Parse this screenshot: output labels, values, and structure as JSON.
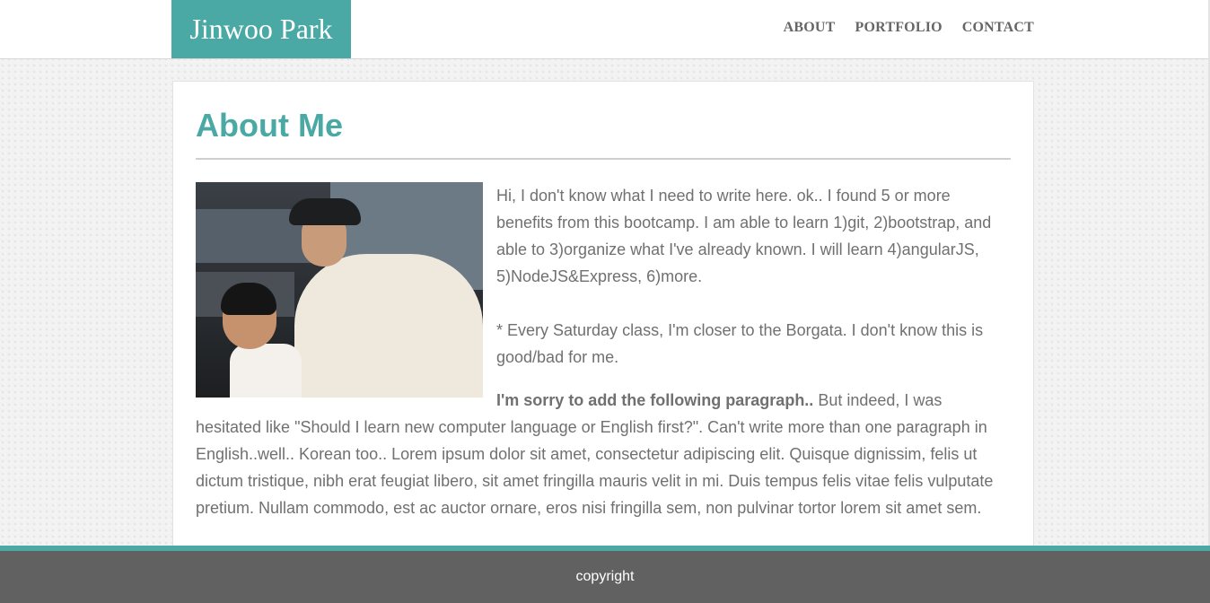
{
  "header": {
    "brand": "Jinwoo Park",
    "nav": [
      "ABOUT",
      "PORTFOLIO",
      "CONTACT"
    ]
  },
  "main": {
    "title": "About Me",
    "paragraph1": "Hi, I don't know what I need to write here. ok.. I found 5 or more benefits from this bootcamp. I am able to learn 1)git, 2)bootstrap, and able to 3)organize what I've already known. I will learn 4)angularJS, 5)NodeJS&Express, 6)more.",
    "paragraph2": "* Every Saturday class, I'm closer to the Borgata. I don't know this is good/bad for me.",
    "paragraph3_bold": "I'm sorry to add the following paragraph..",
    "paragraph3_rest": " But indeed, I was hesitated like \"Should I learn new computer language or English first?\". Can't write more than one paragraph in English..well.. Korean too.. Lorem ipsum dolor sit amet, consectetur adipiscing elit. Quisque dignissim, felis ut dictum tristique, nibh erat feugiat libero, sit amet fringilla mauris velit in mi. Duis tempus felis vitae felis vulputate pretium. Nullam commodo, est ac auctor ornare, eros nisi fringilla sem, non pulvinar tortor lorem sit amet sem."
  },
  "footer": {
    "text": "copyright"
  },
  "colors": {
    "accent": "#4aa9a4",
    "footer_bg": "#616161",
    "text": "#707070"
  }
}
